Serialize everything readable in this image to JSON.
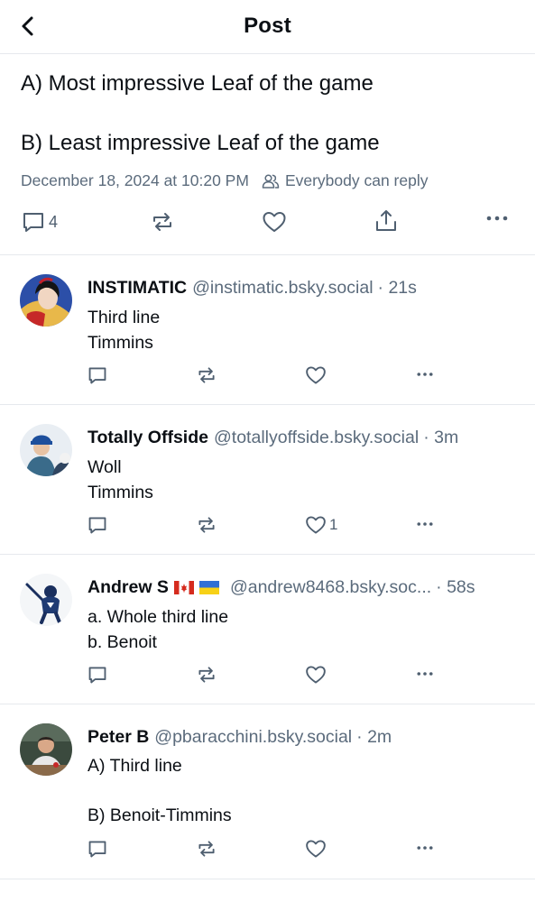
{
  "header": {
    "title": "Post",
    "back_icon": "chevron-left-icon"
  },
  "post": {
    "line1": "A) Most impressive Leaf of the game",
    "line2": "B) Least impressive Leaf of the game",
    "timestamp": "December 18, 2024 at 10:20 PM",
    "reply_setting": "Everybody can reply",
    "reply_count": "4"
  },
  "replies": [
    {
      "name": "INSTIMATIC",
      "handle": "@instimatic.bsky.social",
      "time": "· 21s",
      "lines": [
        "Third line",
        "Timmins"
      ],
      "like_count": ""
    },
    {
      "name": "Totally Offside",
      "handle": "@totallyoffside.bsky.social",
      "time": "· 3m",
      "lines": [
        "Woll",
        "Timmins"
      ],
      "like_count": "1"
    },
    {
      "name": "Andrew S",
      "flags": [
        "canada-flag",
        "ukraine-flag"
      ],
      "handle": "@andrew8468.bsky.soc...",
      "time": "· 58s",
      "lines": [
        "a. Whole third line",
        "b. Benoit"
      ],
      "like_count": ""
    },
    {
      "name": "Peter B",
      "handle": "@pbaracchini.bsky.social",
      "time": "· 2m",
      "lines": [
        "A) Third line",
        "",
        "B) Benoit-Timmins"
      ],
      "like_count": ""
    }
  ],
  "colors": {
    "text": "#0b0f14",
    "muted": "#5b6b7c",
    "icon": "#4f5f70",
    "divider": "#e6e9ed"
  }
}
